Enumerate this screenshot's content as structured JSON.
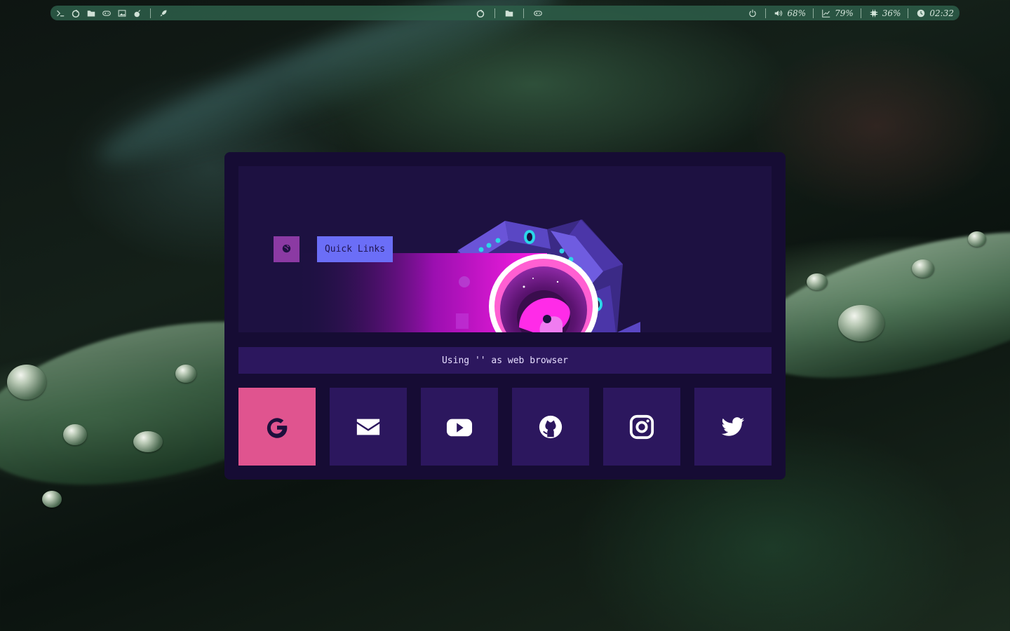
{
  "topbar": {
    "left_icons": [
      "terminal-icon",
      "firefox-icon",
      "folder-icon",
      "gamepad-icon",
      "image-icon",
      "bomb-icon",
      "rocket-icon"
    ],
    "center_icons": [
      "firefox-icon",
      "folder-icon",
      "gamepad-icon"
    ],
    "power_icon": "power-icon",
    "volume": {
      "icon": "volume-icon",
      "value": "68%"
    },
    "cpu": {
      "icon": "chart-line-icon",
      "value": "79%"
    },
    "memory": {
      "icon": "chip-icon",
      "value": "36%"
    },
    "clock": {
      "icon": "clock-icon",
      "value": "02:32"
    }
  },
  "startpage": {
    "quick_links_label": "Quick Links",
    "globe_icon": "globe-icon",
    "browser_info": "Using '' as web browser",
    "links": [
      {
        "name": "google-link",
        "icon": "google-icon",
        "active": true
      },
      {
        "name": "mail-link",
        "icon": "envelope-icon",
        "active": false
      },
      {
        "name": "youtube-link",
        "icon": "youtube-icon",
        "active": false
      },
      {
        "name": "github-link",
        "icon": "github-icon",
        "active": false
      },
      {
        "name": "instagram-link",
        "icon": "instagram-icon",
        "active": false
      },
      {
        "name": "twitter-link",
        "icon": "twitter-icon",
        "active": false
      }
    ]
  },
  "colors": {
    "bar_bg": "#2c5c48",
    "card_bg": "#160c34",
    "banner_bg": "#1d1141",
    "tile_bg": "#2c175e",
    "active_tile": "#e0548f",
    "quick_links_bg": "#6b6ef7",
    "globe_bg": "#8b3aa3"
  }
}
